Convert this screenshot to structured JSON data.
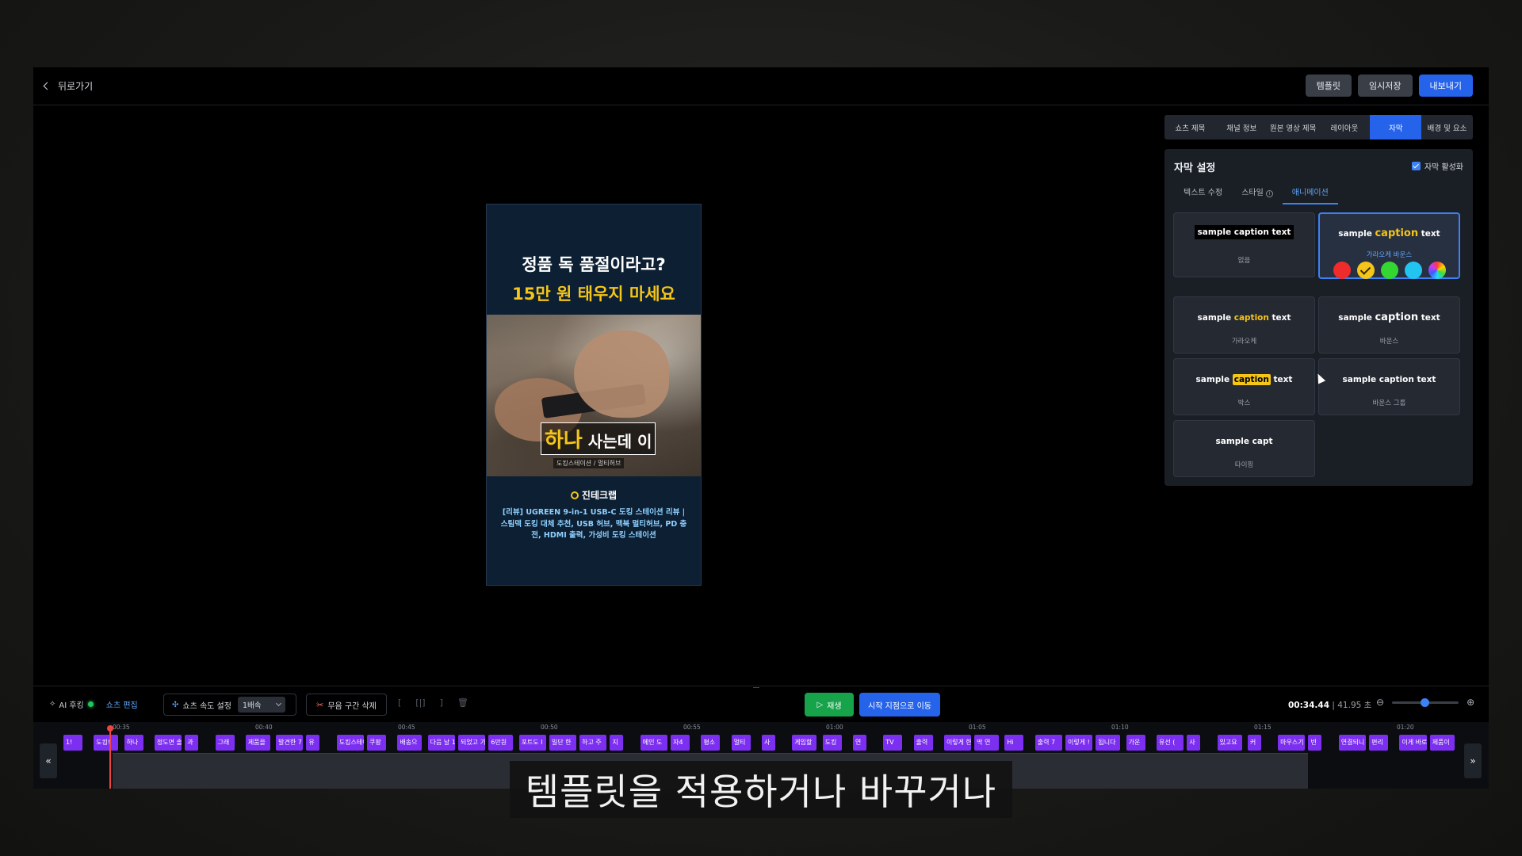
{
  "topbar": {
    "back_label": "뒤로가기",
    "template_label": "템플릿",
    "save_label": "임시저장",
    "export_label": "내보내기"
  },
  "preview": {
    "headline_line1": "정품 독 품절이라고?",
    "headline_line2": "15만 원 태우지 마세요",
    "caption_highlight": "하나",
    "caption_rest": " 사는데 이",
    "sub_caption": "도킹스테이션 / 멀티허브",
    "channel": "진테크랩",
    "description": "[리뷰] UGREEN 9-in-1 USB-C 도킹 스테이션 리뷰 | 스팀덱 도킹 대체 추천, USB 허브, 맥북 멀티허브, PD 충전, HDMI 출력, 가성비 도킹 스테이션"
  },
  "tabs": [
    "쇼츠 제목",
    "채널 정보",
    "원본 영상 제목",
    "레이아웃",
    "자막",
    "배경 및 요소"
  ],
  "panel": {
    "title": "자막 설정",
    "enable_label": "자막 활성화",
    "subtabs": [
      "텍스트 수정",
      "스타일",
      "애니메이션"
    ],
    "cards": [
      {
        "sample": "sample caption text",
        "name": "없음"
      },
      {
        "sample_pre": "sample ",
        "sample_hl": "caption",
        "sample_post": " text",
        "name": "가라오케 바운스"
      },
      {
        "sample_pre": "sample ",
        "sample_hl": "caption",
        "sample_post": " text",
        "name": "가라오케"
      },
      {
        "sample_pre": "sample ",
        "sample_hl": "caption",
        "sample_post": " text",
        "name": "바운스"
      },
      {
        "sample_pre": "sample ",
        "sample_hl": "caption",
        "sample_post": " text",
        "name": "박스"
      },
      {
        "sample": "sample caption text",
        "name": "바운스 그룹"
      },
      {
        "sample": "sample capt",
        "name": "타이핑"
      }
    ],
    "swatch_colors": [
      "#ef2b2b",
      "#f5c518",
      "#34d631",
      "#22c4f0",
      "rainbow"
    ]
  },
  "bottombar": {
    "ai_hook": "AI 후킹",
    "shorts_edit": "쇼츠 편집",
    "speed_label": "쇼츠 속도 설정",
    "speed_value": "1배속",
    "silent_delete": "무음 구간 삭제",
    "play": "재생",
    "goto_start": "시작 지점으로 이동",
    "current_time": "00:34.44",
    "duration": " | 41.95 초"
  },
  "timeline": {
    "ticks": [
      "00:35",
      "00:40",
      "00:45",
      "00:50",
      "00:55",
      "01:00",
      "01:05",
      "01:10",
      "01:15",
      "01:20"
    ],
    "clips": [
      "1!",
      "도킹!",
      "하나",
      "정도면 솔직",
      "과",
      "그래",
      "제품을",
      "발견한 7",
      "유",
      "도킹스테이",
      "쿠팡",
      "배송으",
      "다음 날 1",
      "되었고 가",
      "6만원",
      "포트도 I",
      "일단 한",
      "하고 주",
      "지",
      "메인 도",
      "자4",
      "평소",
      "멀티",
      "사",
      "게임할",
      "도킹",
      "연",
      "TV",
      "출력",
      "이렇게 한 줄로",
      "딱 연",
      "Hi",
      "출력 7",
      "이렇게 !",
      "됩니다",
      "가운",
      "유선 (",
      "사",
      "있고요",
      "커",
      "마우스기",
      "빈",
      "연결되니",
      "편리",
      "이게 바로",
      "제품이"
    ]
  },
  "overlay_subtitle": "템플릿을 적용하거나 바꾸거나"
}
